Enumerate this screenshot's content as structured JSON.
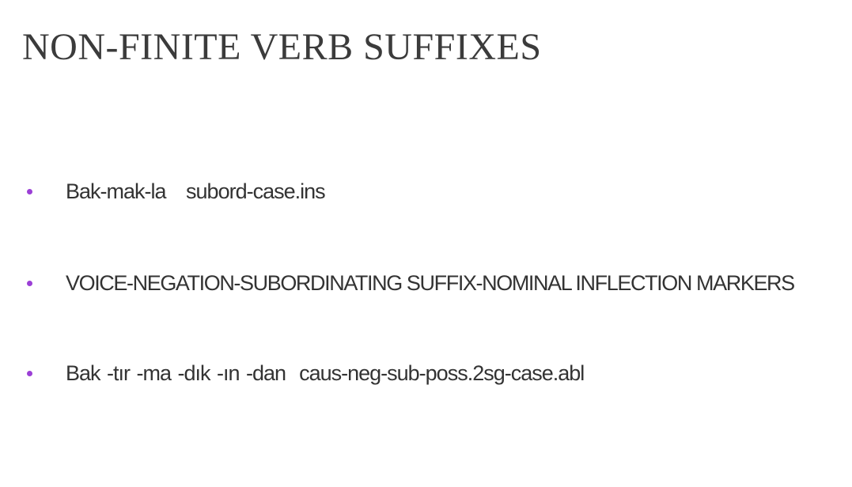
{
  "slide": {
    "title": "NON-FINITE VERB SUFFIXES",
    "bullets": [
      {
        "text": "Bak-mak-la   subord-case.ins"
      },
      {
        "text": "VOICE-NEGATION-SUBORDINATING SUFFIX-NOMINAL INFLECTION MARKERS"
      },
      {
        "text": "Bak -tır -ma -dık -ın -dan  caus-neg-sub-poss.2sg-case.abl"
      }
    ]
  },
  "colors": {
    "title": "#3b3b3b",
    "body_text": "#333333",
    "bullet_marker": "#9b3fd6",
    "background": "#ffffff"
  },
  "icons": {
    "bullet_marker": "bullet-dot-icon"
  }
}
